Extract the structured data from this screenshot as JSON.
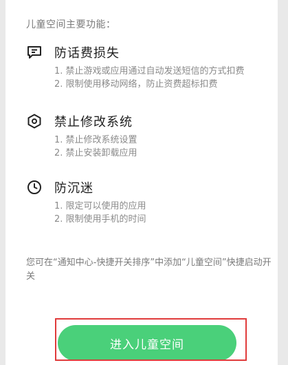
{
  "intro": "儿童空间主要功能：",
  "features": [
    {
      "icon": "message-icon",
      "title": "防话费损失",
      "items": [
        "1. 禁止游戏或应用通过自动发送短信的方式扣费",
        "2. 限制使用移动网络，防止资费超标扣费"
      ]
    },
    {
      "icon": "system-settings-icon",
      "title": "禁止修改系统",
      "items": [
        "1. 禁止修改系统设置",
        "2. 禁止安装卸载应用"
      ]
    },
    {
      "icon": "clock-icon",
      "title": "防沉迷",
      "items": [
        "1. 限定可以使用的应用",
        "2. 限制使用手机的时间"
      ]
    }
  ],
  "note": "您可在“通知中心-快捷开关排序”中添加“儿童空间”快捷启动开关",
  "button": {
    "label": "进入儿童空间",
    "color": "#4ad07a"
  },
  "highlight_color": "#e03a3a"
}
